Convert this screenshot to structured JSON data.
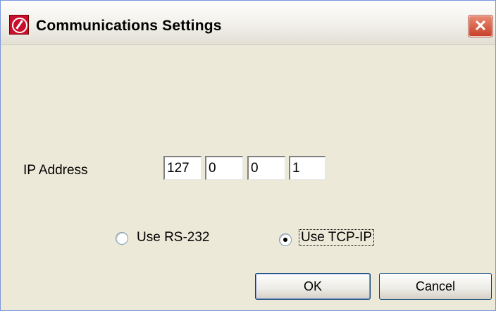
{
  "window": {
    "title": "Communications Settings",
    "icon": "app-logo-icon",
    "close_glyph": "✕"
  },
  "ip_address": {
    "label": "IP Address",
    "octets": [
      "127",
      "0",
      "0",
      "1"
    ]
  },
  "connection": {
    "options": [
      {
        "label": "Use RS-232",
        "checked": false
      },
      {
        "label": "Use TCP-IP",
        "checked": true
      }
    ]
  },
  "buttons": {
    "ok": "OK",
    "cancel": "Cancel"
  },
  "colors": {
    "dialog_bg": "#ECE9D8",
    "close_button": "#C8412A"
  }
}
